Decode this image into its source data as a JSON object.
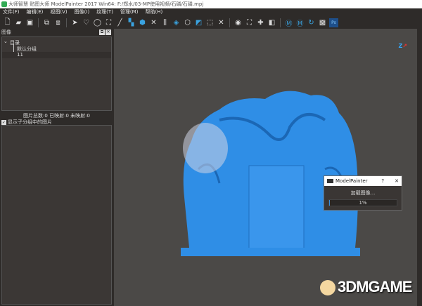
{
  "window": {
    "title": "大师智慧 贴图大师 ModelPainter 2017 Win64: F:/郑水/03-MP使用视频/石磷/石磷.mpj"
  },
  "menu": [
    "文件(F)",
    "编辑(E)",
    "视图(V)",
    "图像(I)",
    "纹理(T)",
    "管理(M)",
    "帮助(H)"
  ],
  "toolbar": [
    "new-file",
    "open-folder",
    "save",
    "import",
    "export",
    "select-arrow",
    "lasso",
    "ellipse-select",
    "rect-select",
    "line",
    "paint",
    "shield",
    "close",
    "split",
    "cube-view",
    "cube",
    "projection",
    "marquee",
    "clear",
    "center",
    "fit",
    "add-points",
    "gradient",
    "camera-m",
    "points-m",
    "rotate",
    "texture",
    "photoshop"
  ],
  "panel": {
    "title": "图像",
    "tree_root": "目录",
    "tree_items": [
      "默认分组",
      "11"
    ],
    "stats": "图片总数:0 已映射:0 未映射:0",
    "show_sub_label": "显示子分组中的图片",
    "show_sub_checked": true
  },
  "dialog": {
    "title": "ModelPainter",
    "help": "?",
    "close": "✕",
    "message": "加载图像...",
    "progress_text": "1%",
    "progress": 1
  },
  "watermark": "3DMGAME",
  "colors": {
    "model": "#2f8ee6",
    "accent": "#3aa3e0"
  }
}
